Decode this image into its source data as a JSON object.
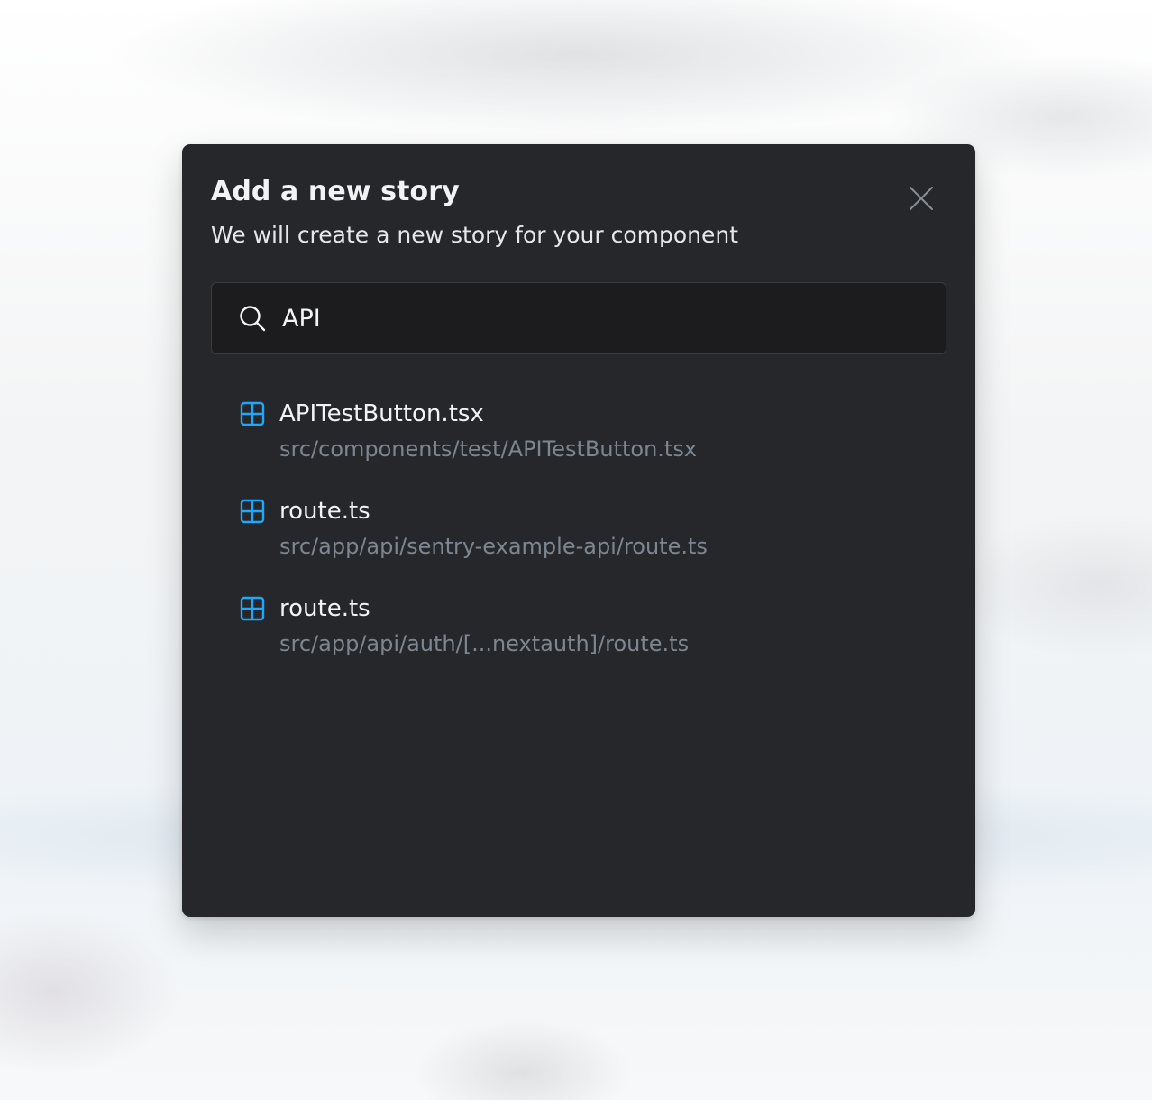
{
  "modal": {
    "title": "Add a new story",
    "subtitle": "We will create a new story for your component",
    "close_icon": "close-icon"
  },
  "search": {
    "value": "API",
    "icon": "search-icon"
  },
  "results": [
    {
      "name": "APITestButton.tsx",
      "path": "src/components/test/APITestButton.tsx",
      "icon": "component-grid-icon"
    },
    {
      "name": "route.ts",
      "path": "src/app/api/sentry-example-api/route.ts",
      "icon": "component-grid-icon"
    },
    {
      "name": "route.ts",
      "path": "src/app/api/auth/[...nextauth]/route.ts",
      "icon": "component-grid-icon"
    }
  ],
  "colors": {
    "modal_background": "#26272a",
    "accent_icon": "#1ea7fd",
    "path_text": "#7d8690"
  }
}
